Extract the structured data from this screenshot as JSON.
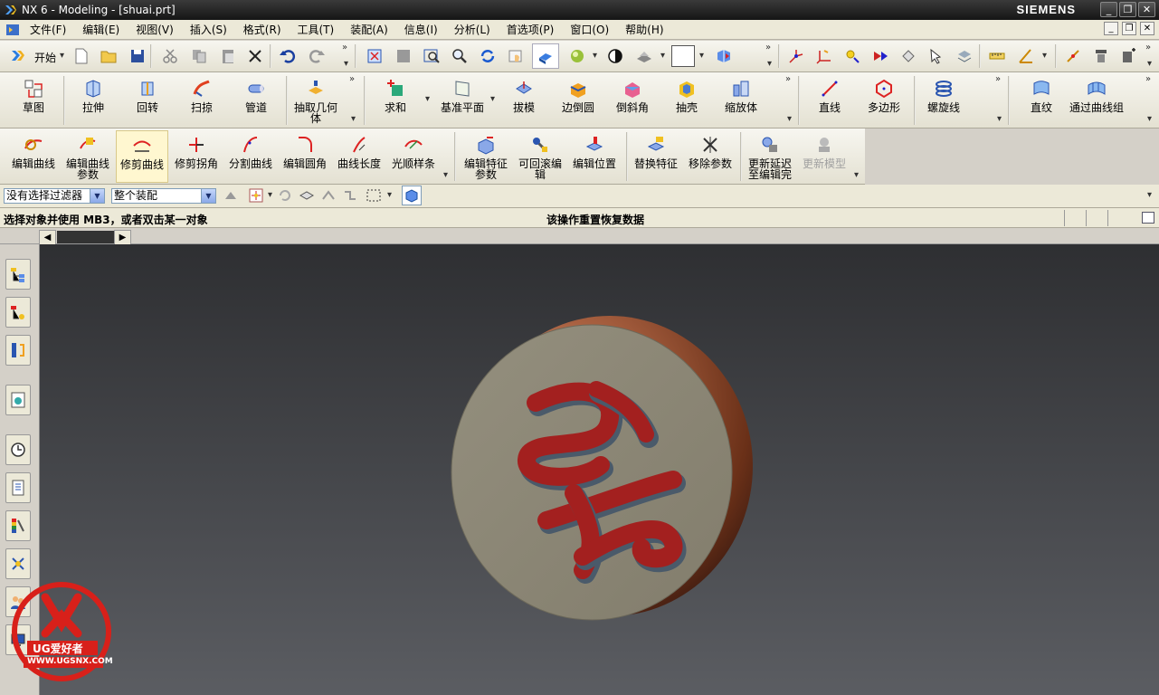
{
  "title_bar": {
    "title": "NX 6 - Modeling - [shuai.prt]",
    "brand": "SIEMENS",
    "controls": [
      "_",
      "❐",
      "✕"
    ]
  },
  "menu": {
    "start_icon": "nx-app-icon",
    "items": [
      "文件(F)",
      "编辑(E)",
      "视图(V)",
      "插入(S)",
      "格式(R)",
      "工具(T)",
      "装配(A)",
      "信息(I)",
      "分析(L)",
      "首选项(P)",
      "窗口(O)",
      "帮助(H)"
    ],
    "mdi_controls": [
      "_",
      "❐",
      "✕"
    ]
  },
  "toolbar_standard": {
    "start_label": "开始"
  },
  "toolbar_features": {
    "items": [
      {
        "label": "草图",
        "icon": "sketch-icon"
      },
      {
        "label": "拉伸",
        "icon": "extrude-icon"
      },
      {
        "label": "回转",
        "icon": "revolve-icon"
      },
      {
        "label": "扫掠",
        "icon": "sweep-icon"
      },
      {
        "label": "管道",
        "icon": "tube-icon"
      },
      {
        "label": "抽取几何体",
        "icon": "extract-geometry-icon"
      },
      {
        "label": "求和",
        "icon": "unite-icon"
      },
      {
        "label": "基准平面",
        "icon": "datum-plane-icon"
      },
      {
        "label": "拔模",
        "icon": "draft-icon"
      },
      {
        "label": "边倒圆",
        "icon": "edge-blend-icon"
      },
      {
        "label": "倒斜角",
        "icon": "chamfer-icon"
      },
      {
        "label": "抽壳",
        "icon": "shell-icon"
      },
      {
        "label": "缩放体",
        "icon": "scale-body-icon"
      },
      {
        "label": "直线",
        "icon": "line-icon"
      },
      {
        "label": "多边形",
        "icon": "polygon-icon"
      },
      {
        "label": "螺旋线",
        "icon": "helix-icon"
      },
      {
        "label": "直纹",
        "icon": "ruled-icon"
      },
      {
        "label": "通过曲线组",
        "icon": "through-curves-icon"
      }
    ]
  },
  "toolbar_edit": {
    "items": [
      {
        "label": "编辑曲线",
        "icon": "edit-curve-icon"
      },
      {
        "label": "编辑曲线参数",
        "icon": "edit-curve-params-icon"
      },
      {
        "label": "修剪曲线",
        "icon": "trim-curve-icon"
      },
      {
        "label": "修剪拐角",
        "icon": "trim-corner-icon"
      },
      {
        "label": "分割曲线",
        "icon": "divide-curve-icon"
      },
      {
        "label": "编辑圆角",
        "icon": "edit-fillet-icon"
      },
      {
        "label": "曲线长度",
        "icon": "curve-length-icon"
      },
      {
        "label": "光顺样条",
        "icon": "smooth-spline-icon"
      },
      {
        "label": "编辑特征参数",
        "icon": "edit-feature-params-icon"
      },
      {
        "label": "可回滚编辑",
        "icon": "rollback-edit-icon"
      },
      {
        "label": "编辑位置",
        "icon": "edit-position-icon"
      },
      {
        "label": "替换特征",
        "icon": "replace-feature-icon"
      },
      {
        "label": "移除参数",
        "icon": "remove-params-icon"
      },
      {
        "label": "更新延迟至编辑完",
        "icon": "delay-update-icon"
      },
      {
        "label": "更新模型",
        "icon": "update-model-icon"
      }
    ]
  },
  "filter_bar": {
    "selection_filter": "没有选择过滤器",
    "scope": "整个装配"
  },
  "status_bar": {
    "prompt": "选择对象并使用 MB3，或者双击某一对象",
    "message": "该操作重置恢复数据"
  },
  "watermark": {
    "text": "UG爱好者",
    "url": "WWW.UGSNX.COM"
  },
  "colors": {
    "title_bar": "#1f1f1f",
    "viewport_top": "#2e2f32",
    "viewport_bottom": "#5b5d62",
    "disc_face": "#8b8777",
    "disc_rim": "#8a4a2c",
    "logo_red": "#a3201f"
  }
}
